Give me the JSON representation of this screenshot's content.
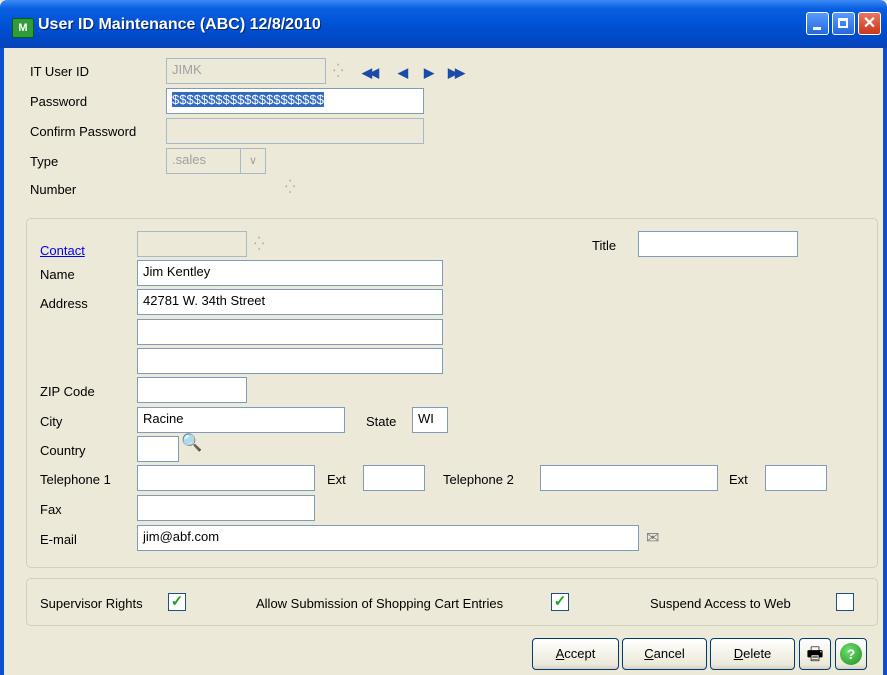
{
  "window": {
    "title": "User ID Maintenance (ABC) 12/8/2010",
    "app_icon": "M",
    "icon_names": [
      "app-icon",
      "minimize-icon",
      "maximize-icon",
      "close-icon"
    ],
    "close_glyph": "✕"
  },
  "header": {
    "user_id_label": "IT User ID",
    "user_id_value": "JIMK",
    "password_label": "Password",
    "password_value": "$$$$$$$$$$$$$$$$$$$$$",
    "confirm_label": "Confirm Password",
    "confirm_value": "",
    "type_label": "Type",
    "type_value": ".sales",
    "type_arrow": "∨",
    "number_label": "Number",
    "nav": {
      "first": "◀◀",
      "prev": "◀",
      "next": "▶",
      "last": "▶▶"
    },
    "nav_icons": [
      "first-record-icon",
      "previous-record-icon",
      "next-record-icon",
      "last-record-icon"
    ]
  },
  "contact": {
    "contact_link": "Contact",
    "contact_value": "",
    "title_label": "Title",
    "title_value": "",
    "name_label": "Name",
    "name_value": "Jim Kentley",
    "address_label": "Address",
    "address_lines": [
      "42781 W. 34th Street",
      "",
      ""
    ],
    "zip_label": "ZIP Code",
    "zip_value": "",
    "city_label": "City",
    "city_value": "Racine",
    "state_label": "State",
    "state_value": "WI",
    "country_label": "Country",
    "country_value": "",
    "tel1_label": "Telephone 1",
    "tel1_value": "",
    "ext1_label": "Ext",
    "ext1_value": "",
    "tel2_label": "Telephone 2",
    "tel2_value": "",
    "ext2_label": "Ext",
    "ext2_value": "",
    "fax_label": "Fax",
    "fax_value": "",
    "email_label": "E-mail",
    "email_value": "jim@abf.com",
    "lookup_glyph": "⁛",
    "search_icon_glyph": "🔍",
    "mail_icon_glyph": "✉"
  },
  "options": {
    "supervisor_label": "Supervisor Rights",
    "supervisor_checked": true,
    "shopping_label": "Allow Submission of Shopping Cart Entries",
    "shopping_checked": true,
    "suspend_label": "Suspend Access to Web",
    "suspend_checked": false,
    "check_glyph": "✓"
  },
  "buttons": {
    "accept": "Accept",
    "cancel": "Cancel",
    "delete": "Delete",
    "print_glyph": "🖶",
    "help_glyph": "?"
  }
}
